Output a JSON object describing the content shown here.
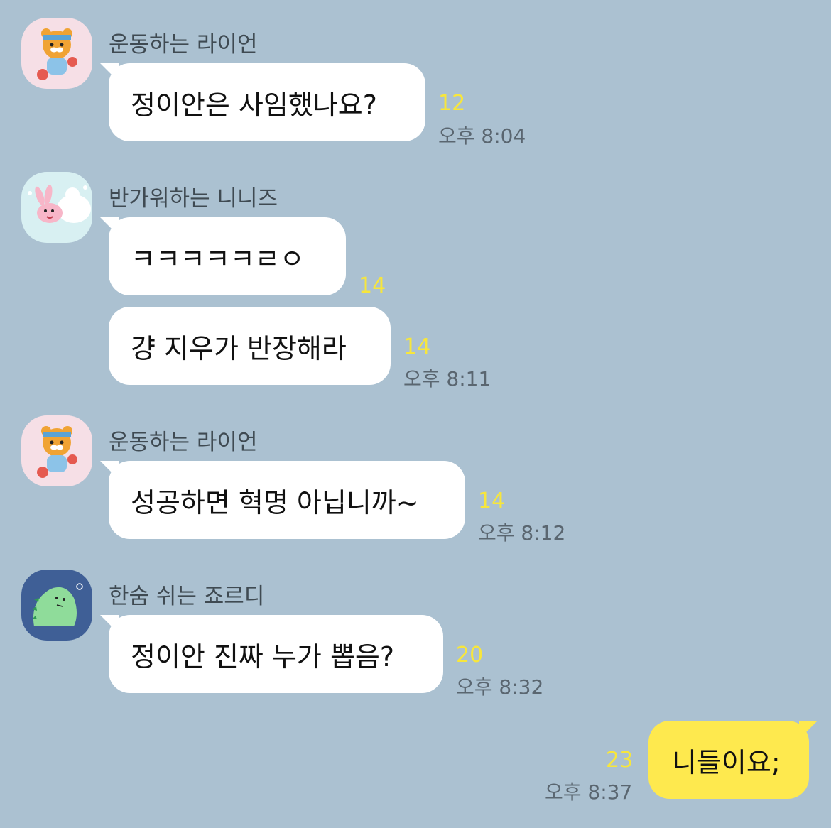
{
  "colors": {
    "background": "#abc1d1",
    "bubble_other": "#ffffff",
    "bubble_mine": "#fee94e",
    "unread": "#f7e63c"
  },
  "messages": [
    {
      "sender": "운동하는 라이언",
      "avatar": "ryan-avatar-icon",
      "text": "정이안은 사임했나요?",
      "unread": "12",
      "time": "오후 8:04"
    },
    {
      "sender": "반가워하는 니니즈",
      "avatar": "niniz-avatar-icon",
      "text": "ㅋㅋㅋㅋㅋㄹㅇ",
      "unread": "14",
      "time": ""
    },
    {
      "sender": "",
      "text": "걍 지우가 반장해라",
      "unread": "14",
      "time": "오후 8:11"
    },
    {
      "sender": "운동하는 라이언",
      "avatar": "ryan-avatar-icon",
      "text": "성공하면 혁명 아닙니까~",
      "unread": "14",
      "time": "오후 8:12"
    },
    {
      "sender": "한숨 쉬는 죠르디",
      "avatar": "jordy-avatar-icon",
      "text": "정이안 진짜 누가 뽑음?",
      "unread": "20",
      "time": "오후 8:32"
    },
    {
      "sender": "me",
      "text": "니들이요;",
      "unread": "23",
      "time": "오후 8:37"
    }
  ]
}
